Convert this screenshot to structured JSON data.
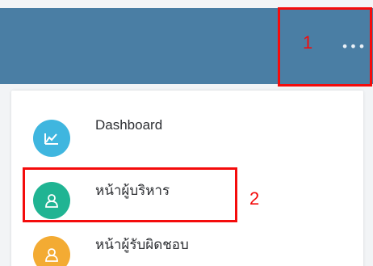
{
  "header": {
    "more_icon": "more-horizontal-icon",
    "more_glyph": "•••",
    "color": "#4a7ea4"
  },
  "annotations": [
    {
      "label": "1",
      "color": "#f40c0c"
    },
    {
      "label": "2",
      "color": "#f40c0c"
    }
  ],
  "menu": {
    "items": [
      {
        "label": "Dashboard",
        "icon": "chart-line-icon",
        "icon_color": "#3fb6df"
      },
      {
        "label": "หน้าผู้บริหาร",
        "icon": "user-icon",
        "icon_color": "#20b493"
      },
      {
        "label": "หน้าผู้รับผิดชอบ",
        "icon": "user-icon",
        "icon_color": "#f3ab33"
      }
    ]
  }
}
